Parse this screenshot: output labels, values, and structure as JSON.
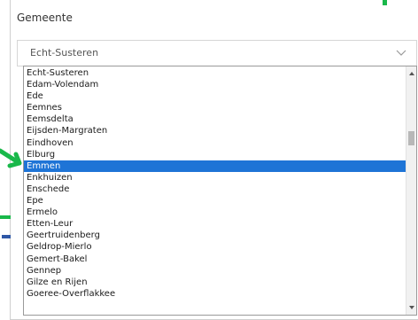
{
  "field": {
    "label": "Gemeente",
    "selected_value": "Echt-Susteren"
  },
  "dropdown": {
    "options": [
      "Echt-Susteren",
      "Edam-Volendam",
      "Ede",
      "Eemnes",
      "Eemsdelta",
      "Eijsden-Margraten",
      "Eindhoven",
      "Elburg",
      "Emmen",
      "Enkhuizen",
      "Enschede",
      "Epe",
      "Ermelo",
      "Etten-Leur",
      "Geertruidenberg",
      "Geldrop-Mierlo",
      "Gemert-Bakel",
      "Gennep",
      "Gilze en Rijen",
      "Goeree-Overflakkee"
    ],
    "highlighted_option": "Emmen"
  },
  "colors": {
    "highlight": "#1e74d6",
    "annotation_arrow": "#19b84a",
    "decoration_green": "#19b84a",
    "decoration_blue": "#2e57a6"
  },
  "icons": {
    "select_chevron": "chevron-down-icon",
    "pointer": "green-arrow-icon",
    "scroll_up": "scroll-up-arrow-icon",
    "scroll_down": "scroll-down-arrow-icon"
  }
}
